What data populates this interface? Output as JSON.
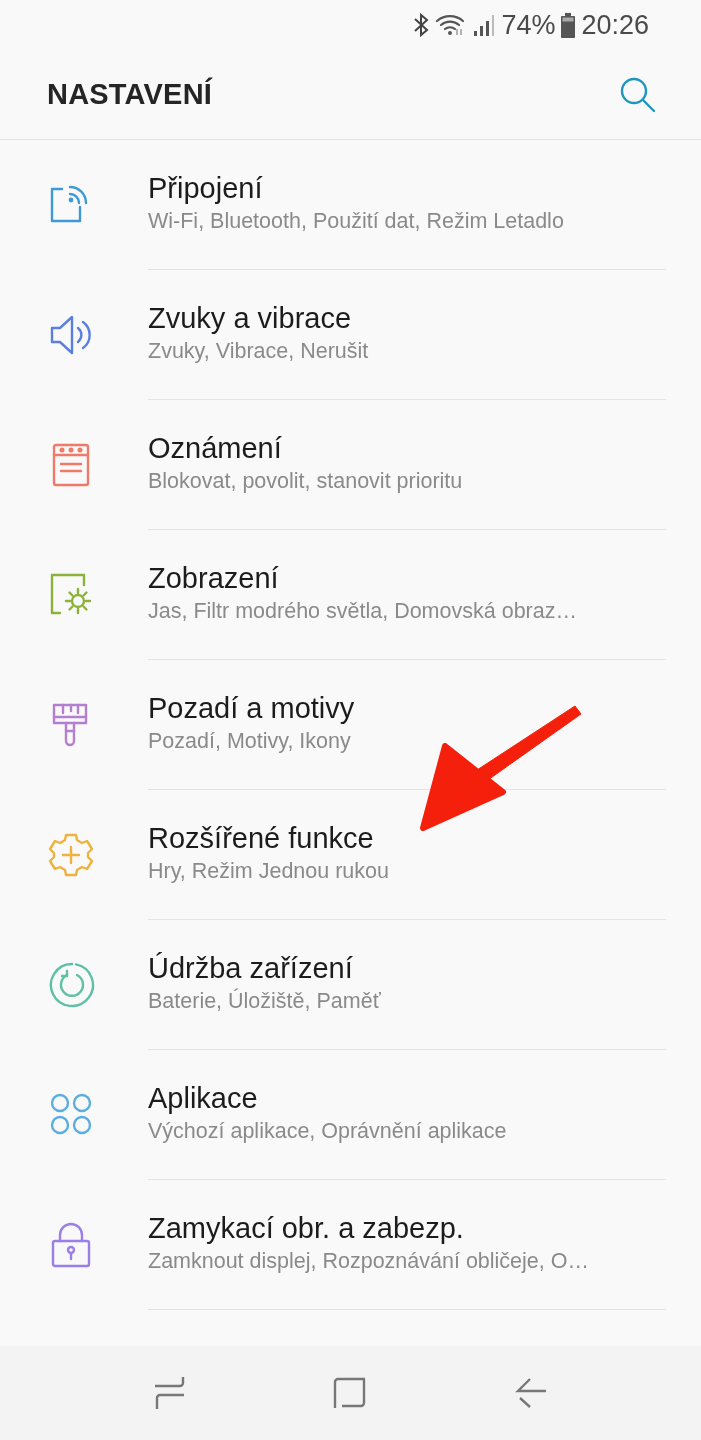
{
  "status_bar": {
    "battery": "74%",
    "time": "20:26"
  },
  "header": {
    "title": "NASTAVENÍ"
  },
  "items": [
    {
      "title": "Připojení",
      "subtitle": "Wi-Fi, Bluetooth, Použití dat, Režim Letadlo",
      "color": "#3d9ad6"
    },
    {
      "title": "Zvuky a vibrace",
      "subtitle": "Zvuky, Vibrace, Nerušit",
      "color": "#5b7fe0"
    },
    {
      "title": "Oznámení",
      "subtitle": "Blokovat, povolit, stanovit prioritu",
      "color": "#f07a68"
    },
    {
      "title": "Zobrazení",
      "subtitle": "Jas, Filtr modrého světla, Domovská obraz…",
      "color": "#8cb23a"
    },
    {
      "title": "Pozadí a motivy",
      "subtitle": "Pozadí, Motivy, Ikony",
      "color": "#b57fd0"
    },
    {
      "title": "Rozšířené funkce",
      "subtitle": "Hry, Režim Jednou rukou",
      "color": "#efb23e"
    },
    {
      "title": "Údržba zařízení",
      "subtitle": "Baterie, Úložiště, Paměť",
      "color": "#5fc0a4"
    },
    {
      "title": "Aplikace",
      "subtitle": "Výchozí aplikace, Oprávnění aplikace",
      "color": "#5aaee0"
    },
    {
      "title": "Zamykací obr. a zabezp.",
      "subtitle": "Zamknout displej, Rozpoznávání obličeje, O…",
      "color": "#9a7fe6"
    }
  ],
  "annotation_arrow": {
    "color": "#f5200c"
  }
}
